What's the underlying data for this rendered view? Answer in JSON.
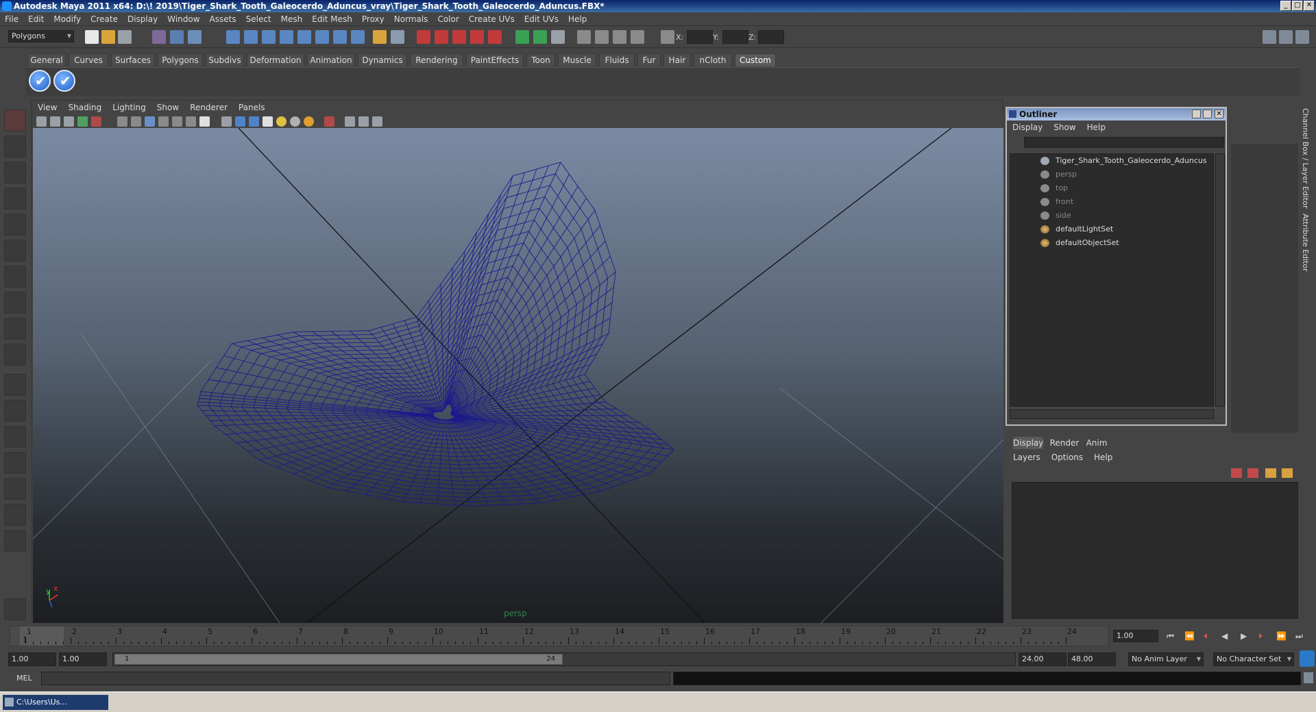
{
  "window": {
    "title": "Autodesk Maya 2011 x64: D:\\! 2019\\Tiger_Shark_Tooth_Galeocerdo_Aduncus_vray\\Tiger_Shark_Tooth_Galeocerdo_Aduncus.FBX*",
    "min": "_",
    "max": "□",
    "close": "✕"
  },
  "menubar": [
    "File",
    "Edit",
    "Modify",
    "Create",
    "Display",
    "Window",
    "Assets",
    "Select",
    "Mesh",
    "Edit Mesh",
    "Proxy",
    "Normals",
    "Color",
    "Create UVs",
    "Edit UVs",
    "Help"
  ],
  "statusline": {
    "mode": "Polygons",
    "x_label": "X:",
    "y_label": "Y:",
    "z_label": "Z:"
  },
  "shelf_tabs": [
    "General",
    "Curves",
    "Surfaces",
    "Polygons",
    "Subdivs",
    "Deformation",
    "Animation",
    "Dynamics",
    "Rendering",
    "PaintEffects",
    "Toon",
    "Muscle",
    "Fluids",
    "Fur",
    "Hair",
    "nCloth",
    "Custom"
  ],
  "shelf_active": "Custom",
  "viewport": {
    "menu": [
      "View",
      "Shading",
      "Lighting",
      "Show",
      "Renderer",
      "Panels"
    ],
    "camera_label": "persp",
    "axis_y": "y",
    "axis_x": "x",
    "mesh_color": "#1a1a8c"
  },
  "outliner": {
    "title": "Outliner",
    "menu": [
      "Display",
      "Show",
      "Help"
    ],
    "items": [
      {
        "label": "Tiger_Shark_Tooth_Galeocerdo_Aduncus",
        "icon": "transform-icon",
        "dim": false
      },
      {
        "label": "persp",
        "icon": "camera-icon",
        "dim": true
      },
      {
        "label": "top",
        "icon": "camera-icon",
        "dim": true
      },
      {
        "label": "front",
        "icon": "camera-icon",
        "dim": true
      },
      {
        "label": "side",
        "icon": "camera-icon",
        "dim": true
      },
      {
        "label": "defaultLightSet",
        "icon": "set-icon",
        "dim": false
      },
      {
        "label": "defaultObjectSet",
        "icon": "set-icon",
        "dim": false
      }
    ]
  },
  "right_strip": {
    "channel_box": "Channel Box / Layer Editor",
    "attribute_editor": "Attribute Editor"
  },
  "layer_editor": {
    "tabs": [
      "Display",
      "Render",
      "Anim"
    ],
    "active_tab": "Display",
    "menu": [
      "Layers",
      "Options",
      "Help"
    ]
  },
  "timeline": {
    "ticks": [
      "1",
      "2",
      "3",
      "4",
      "5",
      "6",
      "7",
      "8",
      "9",
      "10",
      "11",
      "12",
      "13",
      "14",
      "15",
      "16",
      "17",
      "18",
      "19",
      "20",
      "21",
      "22",
      "23",
      "24"
    ],
    "current_frame_label": "1",
    "current_time": "1.00"
  },
  "range": {
    "start": "1.00",
    "playback_start": "1.00",
    "range_start": "1",
    "range_end": "24",
    "playback_end": "24.00",
    "end": "48.00",
    "anim_layer": "No Anim Layer",
    "character_set": "No Character Set"
  },
  "cmdline": {
    "label": "MEL"
  },
  "taskbar": {
    "item": "C:\\Users\\Us..."
  }
}
